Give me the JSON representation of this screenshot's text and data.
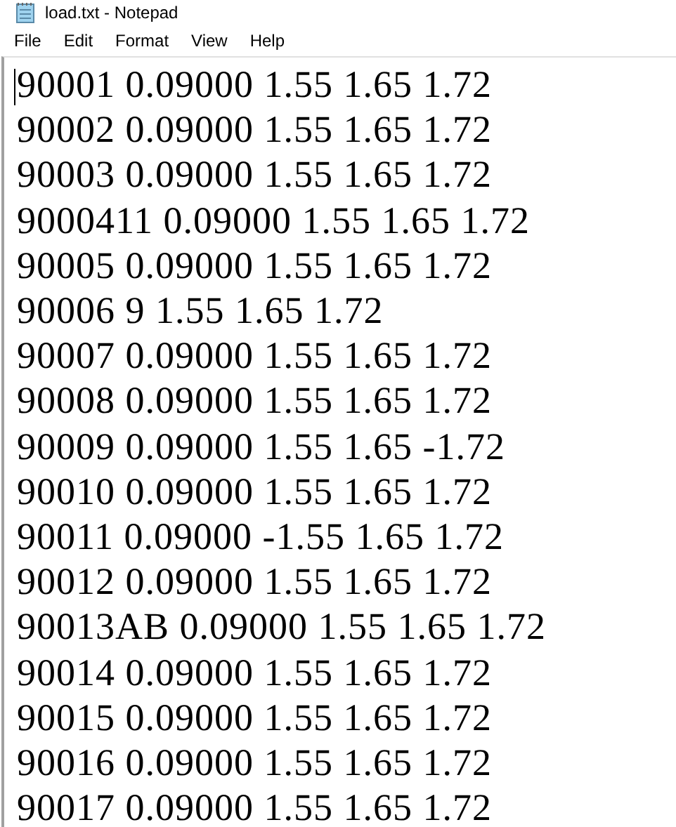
{
  "window": {
    "title": "load.txt - Notepad"
  },
  "menu": [
    "File",
    "Edit",
    "Format",
    "View",
    "Help"
  ],
  "lines": [
    "90001 0.09000 1.55 1.65 1.72",
    "90002 0.09000 1.55 1.65 1.72",
    "90003 0.09000 1.55 1.65 1.72",
    "9000411 0.09000 1.55 1.65 1.72",
    "90005 0.09000 1.55 1.65 1.72",
    "90006 9 1.55 1.65 1.72",
    "90007 0.09000 1.55 1.65 1.72",
    "90008 0.09000 1.55 1.65 1.72",
    "90009 0.09000 1.55 1.65 -1.72",
    "90010 0.09000 1.55 1.65 1.72",
    "90011 0.09000 -1.55 1.65 1.72",
    "90012 0.09000 1.55 1.65 1.72",
    "90013AB 0.09000 1.55 1.65 1.72",
    "90014 0.09000 1.55 1.65 1.72",
    "90015 0.09000 1.55 1.65 1.72",
    "90016 0.09000 1.55 1.65 1.72",
    "90017 0.09000 1.55 1.65 1.72"
  ]
}
